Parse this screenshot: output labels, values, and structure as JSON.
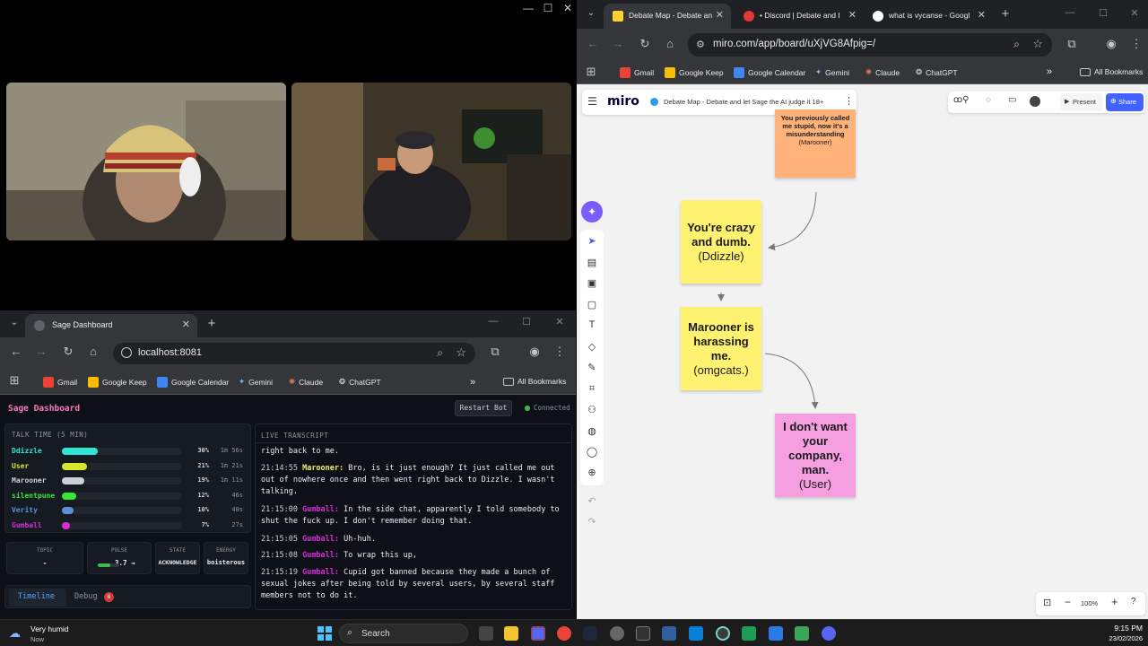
{
  "video_window": {
    "controls": {
      "min": "—",
      "max": "☐",
      "close": "✕"
    }
  },
  "dashboard_browser": {
    "tab_title": "Sage Dashboard",
    "url": "localhost:8081",
    "bookmarks": [
      "Gmail",
      "Google Keep",
      "Google Calendar",
      "Gemini",
      "Claude",
      "ChatGPT"
    ],
    "all_bookmarks": "All Bookmarks"
  },
  "dashboard": {
    "title": "Sage Dashboard",
    "restart_label": "Restart Bot",
    "status": "Connected",
    "talk_time_title": "TALK TIME (5 MIN)",
    "talk_time": [
      {
        "name": "Ddizzle",
        "pct": "30%",
        "time": "1m 56s",
        "fill": 0.3,
        "color": "#2ee6d6"
      },
      {
        "name": "User",
        "pct": "21%",
        "time": "1m 21s",
        "fill": 0.21,
        "color": "#d6e62e"
      },
      {
        "name": "Marooner",
        "pct": "19%",
        "time": "1m 11s",
        "fill": 0.19,
        "color": "#c9d1d9"
      },
      {
        "name": "silentpune",
        "pct": "12%",
        "time": "46s",
        "fill": 0.12,
        "color": "#39e639"
      },
      {
        "name": "Verity",
        "pct": "10%",
        "time": "40s",
        "fill": 0.1,
        "color": "#5c8fd6"
      },
      {
        "name": "Gumball",
        "pct": "7%",
        "time": "27s",
        "fill": 0.07,
        "color": "#d62ed6"
      }
    ],
    "stats": {
      "topic_label": "TOPIC",
      "topic_value": "-",
      "pulse_label": "PULSE",
      "pulse_value": "3.7 →",
      "state_label": "STATE",
      "state_value": "ACKNOWLEDGE",
      "energy_label": "ENERGY",
      "energy_value": "boisterous"
    },
    "tabs": {
      "timeline": "Timeline",
      "debug": "Debug",
      "debug_badge": "8"
    },
    "transcript_title": "LIVE TRANSCRIPT",
    "transcript": [
      {
        "time": "",
        "speaker": "",
        "text": "right back to me.",
        "color": "#e6edf3"
      },
      {
        "time": "21:14:55",
        "speaker": "Marooner:",
        "text": "Bro, is it just enough? It just called me out out of nowhere once and then went right back to Dizzle. I wasn't talking.",
        "color": "#f0f06a"
      },
      {
        "time": "21:15:00",
        "speaker": "Gumball:",
        "text": "In the side chat, apparently I told somebody to shut the fuck up. I don't remember doing that.",
        "color": "#d62ed6"
      },
      {
        "time": "21:15:05",
        "speaker": "Gumball:",
        "text": "Uh-huh.",
        "color": "#d62ed6"
      },
      {
        "time": "21:15:08",
        "speaker": "Gumball:",
        "text": "To wrap this up,",
        "color": "#d62ed6"
      },
      {
        "time": "21:15:19",
        "speaker": "Gumball:",
        "text": "Cupid got banned because they made a bunch of sexual jokes after being told by several users, by several staff members not to do it.",
        "color": "#d62ed6"
      }
    ]
  },
  "miro_browser": {
    "tabs": [
      "Debate Map - Debate an",
      "• Discord | Debate and I",
      "what is vycanse - Googl"
    ],
    "url": "miro.com/app/board/uXjVG8Afpig=/",
    "bookmarks": [
      "Gmail",
      "Google Keep",
      "Google Calendar",
      "Gemini",
      "Claude",
      "ChatGPT"
    ],
    "all_bookmarks": "All Bookmarks"
  },
  "miro": {
    "logo": "miro",
    "board_title": "Debate Map - Debate and let Sage the AI judge it 18+",
    "present_label": "Present",
    "share_label": "Share",
    "zoom": "100%",
    "stickies": [
      {
        "text": "You previously called me stupid, now it's a misunderstanding",
        "by": "(Marooner)",
        "color": "#ffb27a"
      },
      {
        "text": "You're crazy and dumb.",
        "by": "(Ddizzle)",
        "color": "#fff270"
      },
      {
        "text": "Marooner is harassing me.",
        "by": "(omgcats.)",
        "color": "#fff270"
      },
      {
        "text": "I don't want your company, man.",
        "by": "(User)",
        "color": "#f59fe0"
      }
    ]
  },
  "taskbar": {
    "weather": "Very humid",
    "weather_sub": "Now",
    "search": "Search",
    "time": "9:15 PM",
    "date": "23/02/2026"
  }
}
